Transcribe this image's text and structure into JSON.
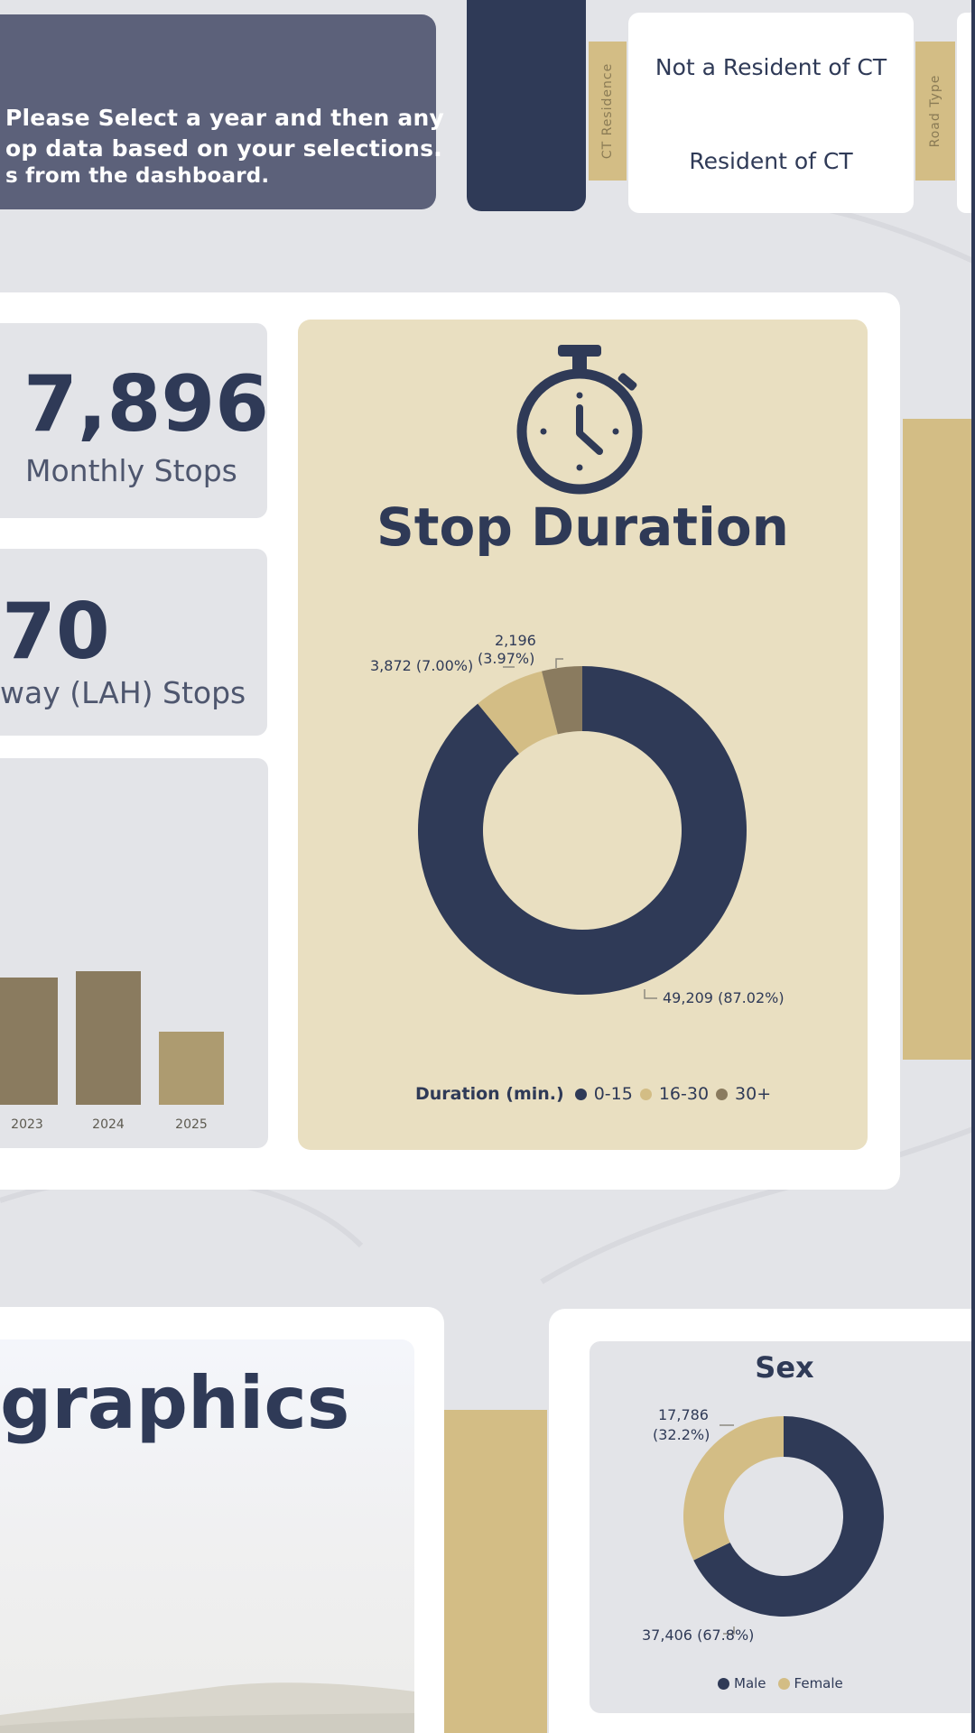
{
  "colors": {
    "navy": "#2f3a57",
    "gold": "#d3bd85",
    "tan": "#e9dfc1",
    "olive": "#8a7b5f",
    "bar_gold": "#ad9b70",
    "grey": "#e3e4e8"
  },
  "intro": {
    "line1": "Please Select a year and then any",
    "line2": "op data based on your selections.",
    "line3": "s from the dashboard."
  },
  "filters": {
    "ct_residence_label": "CT Residence",
    "road_type_label": "Road Type",
    "options": [
      "Not a Resident of CT",
      "Resident of CT"
    ]
  },
  "kpis": {
    "monthly_value": "7,896",
    "monthly_label": "Monthly Stops",
    "lah_value": "70",
    "lah_label": "way (LAH) Stops"
  },
  "year_bars": {
    "labels": [
      "2023",
      "2024",
      "2025"
    ],
    "heights_relative": [
      0.95,
      1.0,
      0.55
    ]
  },
  "stop_duration": {
    "icon": "stopwatch-icon",
    "title": "Stop Duration",
    "legend_title": "Duration (min.)",
    "labels": {
      "b": "49,209 (87.02%)",
      "c": "3,872 (7.00%)",
      "d1": "2,196",
      "d2": "(3.97%)"
    }
  },
  "demographics": {
    "title": "graphics"
  },
  "sex": {
    "title": "Sex",
    "labels": {
      "female1": "17,786",
      "female2": "(32.2%)",
      "male": "37,406 (67.8%)"
    },
    "legend": [
      "Male",
      "Female"
    ]
  },
  "chart_data": [
    {
      "type": "pie",
      "title": "Stop Duration",
      "legend_title": "Duration (min.)",
      "categories": [
        "0-15",
        "16-30",
        "30+"
      ],
      "values": [
        49209,
        3872,
        2196
      ],
      "percents": [
        87.02,
        7.0,
        3.97
      ],
      "colors": [
        "#2f3a57",
        "#d3bd85",
        "#8a7b5f"
      ],
      "legend_position": "bottom"
    },
    {
      "type": "pie",
      "title": "Sex",
      "categories": [
        "Male",
        "Female"
      ],
      "values": [
        37406,
        17786
      ],
      "percents": [
        67.8,
        32.2
      ],
      "colors": [
        "#2f3a57",
        "#d3bd85"
      ],
      "legend_position": "bottom"
    }
  ]
}
